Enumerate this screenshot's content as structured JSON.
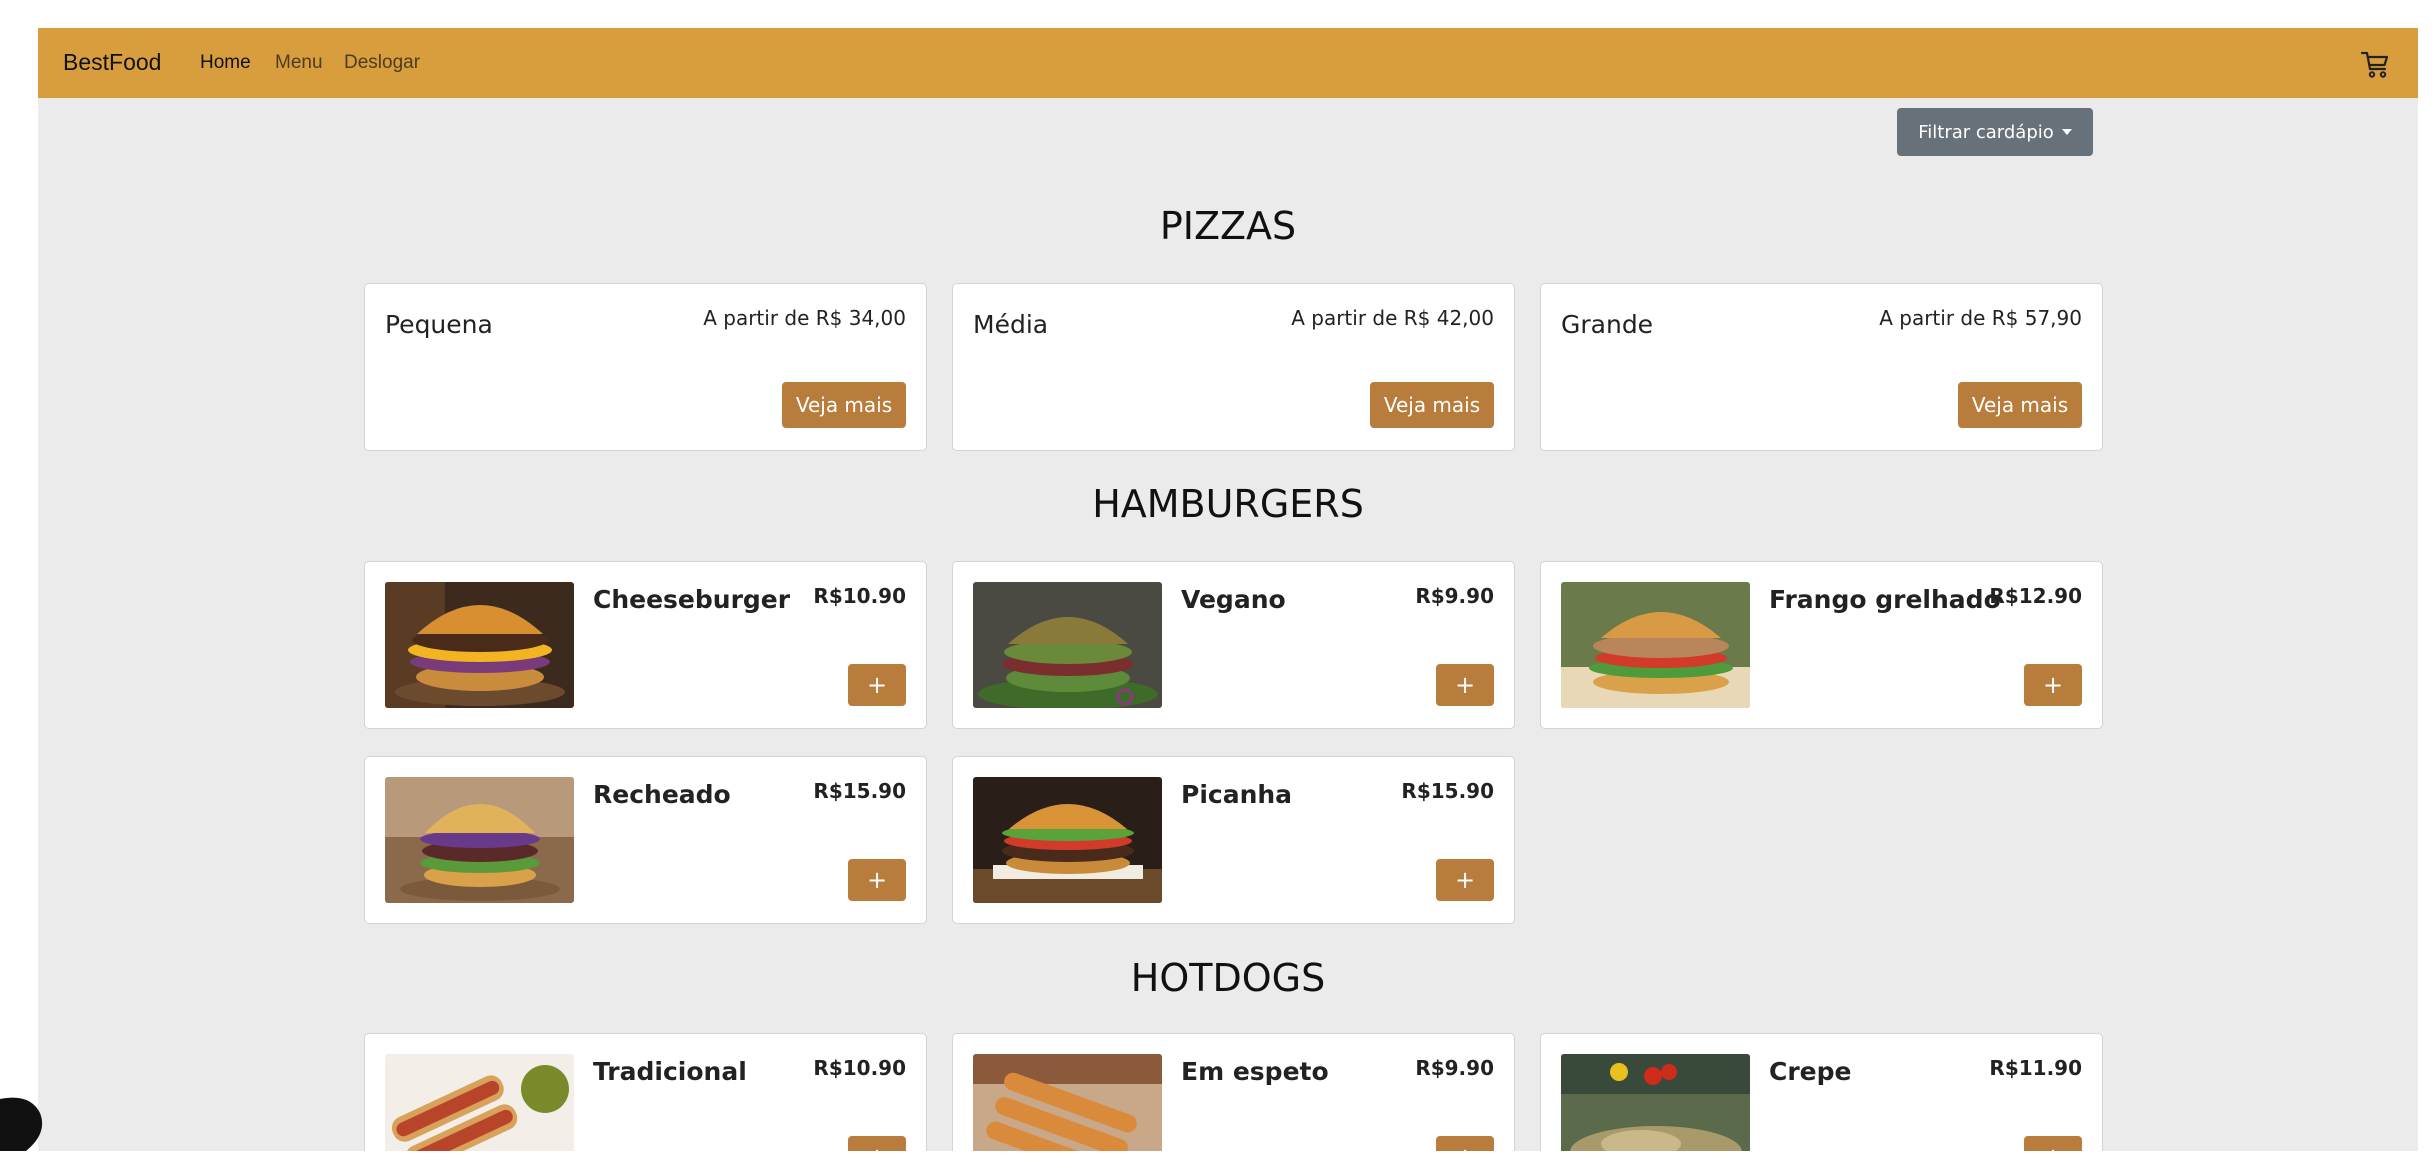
{
  "navbar": {
    "brand": "BestFood",
    "links": [
      "Home",
      "Menu",
      "Deslogar"
    ]
  },
  "filter": {
    "label": "Filtrar cardápio"
  },
  "sections": {
    "pizzas": {
      "title": "PIZZAS",
      "items": [
        {
          "name": "Pequena",
          "price": "A partir de R$ 34,00",
          "button": "Veja mais"
        },
        {
          "name": "Média",
          "price": "A partir de R$ 42,00",
          "button": "Veja mais"
        },
        {
          "name": "Grande",
          "price": "A partir de R$ 57,90",
          "button": "Veja mais"
        }
      ]
    },
    "hamburgers": {
      "title": "HAMBURGERS",
      "items": [
        {
          "name": "Cheeseburger",
          "price": "R$10.90",
          "button": "+"
        },
        {
          "name": "Vegano",
          "price": "R$9.90",
          "button": "+"
        },
        {
          "name": "Frango grelhado",
          "price": "R$12.90",
          "button": "+"
        },
        {
          "name": "Recheado",
          "price": "R$15.90",
          "button": "+"
        },
        {
          "name": "Picanha",
          "price": "R$15.90",
          "button": "+"
        }
      ]
    },
    "hotdogs": {
      "title": "HOTDOGS",
      "items": [
        {
          "name": "Tradicional",
          "price": "R$10.90",
          "button": "+"
        },
        {
          "name": "Em espeto",
          "price": "R$9.90",
          "button": "+"
        },
        {
          "name": "Crepe",
          "price": "R$11.90",
          "button": "+"
        }
      ]
    }
  },
  "colors": {
    "navbar": "#d89e3d",
    "background": "#ebebeb",
    "button": "#b87d3c",
    "filter_button": "#67717a"
  },
  "icons": {
    "cart": "cart-icon",
    "caret": "caret-down-icon"
  }
}
